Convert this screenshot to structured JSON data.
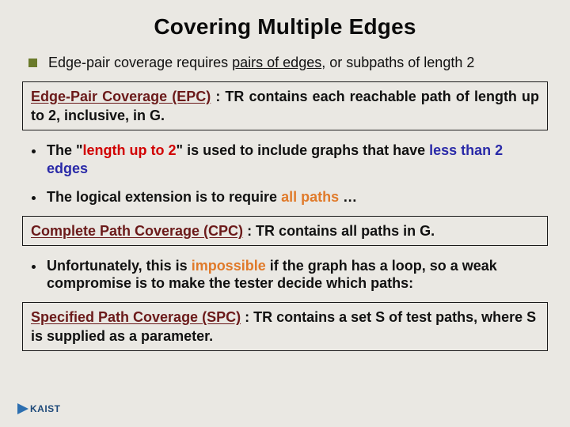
{
  "title": "Covering Multiple Edges",
  "bullet1": {
    "pre": "Edge-pair coverage requires ",
    "underlined": "pairs of edges",
    "post": ", or subpaths of length 2"
  },
  "def_epc": {
    "name": "Edge-Pair Coverage (EPC)",
    "body": " : TR contains each reachable path of length up to 2, inclusive, in G."
  },
  "bullet2": {
    "pre": "The \"",
    "redpart": "length up to 2",
    "mid": "\" is used to include graphs that have ",
    "bluepart": "less than 2 edges"
  },
  "bullet3": {
    "pre": "The logical extension is to require ",
    "orangepart": "all paths",
    "post": " …"
  },
  "def_cpc": {
    "name": "Complete Path Coverage (CPC)",
    "body": " : TR contains all paths in G."
  },
  "bullet4": {
    "pre": "Unfortunately, this is ",
    "orangepart": "impossible",
    "post": " if the graph has a loop, so a weak compromise is to make the tester decide which paths:"
  },
  "def_spc": {
    "name": "Specified Path Coverage (SPC)",
    "body": " : TR contains a set S of test paths, where S is supplied as a parameter."
  },
  "logo_text": "KAIST"
}
